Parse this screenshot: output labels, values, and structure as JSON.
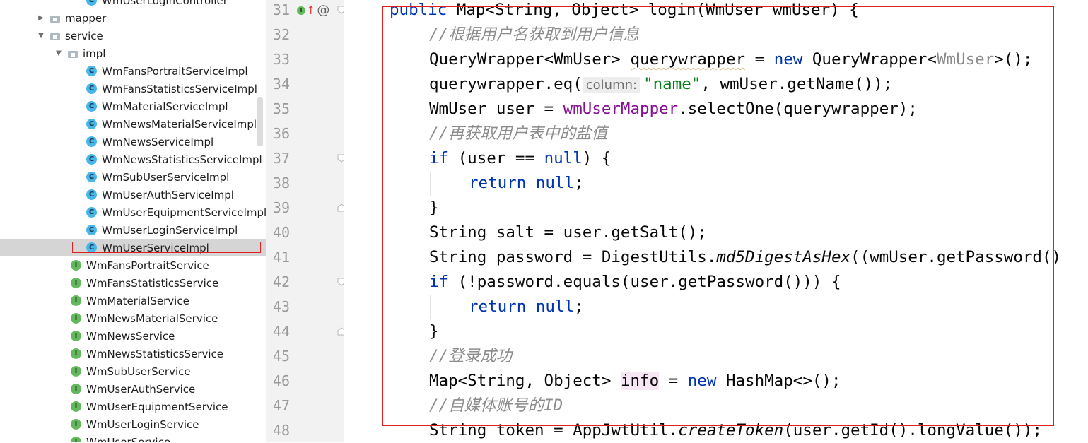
{
  "project_tree": {
    "items": [
      {
        "label": "WmUserLoginController",
        "type": "class",
        "depth": 2
      },
      {
        "label": "mapper",
        "type": "folder",
        "depth": 0,
        "expanded": false
      },
      {
        "label": "service",
        "type": "folder",
        "depth": 0,
        "expanded": true
      },
      {
        "label": "impl",
        "type": "folder",
        "depth": 1,
        "expanded": true
      },
      {
        "label": "WmFansPortraitServiceImpl",
        "type": "class",
        "depth": 2
      },
      {
        "label": "WmFansStatisticsServiceImpl",
        "type": "class",
        "depth": 2
      },
      {
        "label": "WmMaterialServiceImpl",
        "type": "class",
        "depth": 2
      },
      {
        "label": "WmNewsMaterialServiceImpl",
        "type": "class",
        "depth": 2
      },
      {
        "label": "WmNewsServiceImpl",
        "type": "class",
        "depth": 2
      },
      {
        "label": "WmNewsStatisticsServiceImpl",
        "type": "class",
        "depth": 2
      },
      {
        "label": "WmSubUserServiceImpl",
        "type": "class",
        "depth": 2
      },
      {
        "label": "WmUserAuthServiceImpl",
        "type": "class",
        "depth": 2
      },
      {
        "label": "WmUserEquipmentServiceImpl",
        "type": "class",
        "depth": 2
      },
      {
        "label": "WmUserLoginServiceImpl",
        "type": "class",
        "depth": 2
      },
      {
        "label": "WmUserServiceImpl",
        "type": "class",
        "depth": 2,
        "selected": true
      },
      {
        "label": "WmFansPortraitService",
        "type": "interface",
        "depth": 1
      },
      {
        "label": "WmFansStatisticsService",
        "type": "interface",
        "depth": 1
      },
      {
        "label": "WmMaterialService",
        "type": "interface",
        "depth": 1
      },
      {
        "label": "WmNewsMaterialService",
        "type": "interface",
        "depth": 1
      },
      {
        "label": "WmNewsService",
        "type": "interface",
        "depth": 1
      },
      {
        "label": "WmNewsStatisticsService",
        "type": "interface",
        "depth": 1
      },
      {
        "label": "WmSubUserService",
        "type": "interface",
        "depth": 1
      },
      {
        "label": "WmUserAuthService",
        "type": "interface",
        "depth": 1
      },
      {
        "label": "WmUserEquipmentService",
        "type": "interface",
        "depth": 1
      },
      {
        "label": "WmUserLoginService",
        "type": "interface",
        "depth": 1
      },
      {
        "label": "WmUserService",
        "type": "interface",
        "depth": 1
      }
    ],
    "icons": {
      "class": "C",
      "interface": "I"
    }
  },
  "gutter": {
    "line_numbers": [
      "31",
      "32",
      "33",
      "34",
      "35",
      "36",
      "37",
      "38",
      "39",
      "40",
      "41",
      "42",
      "43",
      "44",
      "45",
      "46",
      "47",
      "48"
    ],
    "impl_badge": "I",
    "override_up": "↑",
    "override_at": "@"
  },
  "colors": {
    "keyword": "#0033b3",
    "string": "#067d17",
    "field": "#871094",
    "comment": "#8c8c8c",
    "highlight_box": "#e02020",
    "selection": "#d5d5d5"
  },
  "code": {
    "lines": [
      {
        "indent": 0,
        "tokens": [
          {
            "t": "public",
            "c": "kw"
          },
          {
            "t": " Map<String, Object> login(WmUser wmUser) {"
          }
        ]
      },
      {
        "indent": 1,
        "tokens": [
          {
            "t": "//根据用户名获取到用户信息",
            "c": "cmt"
          }
        ]
      },
      {
        "indent": 1,
        "tokens": [
          {
            "t": "QueryWrapper<WmUser> "
          },
          {
            "t": "querywrapper",
            "c": "uwave"
          },
          {
            "t": " = "
          },
          {
            "t": "new",
            "c": "kw"
          },
          {
            "t": " QueryWrapper<"
          },
          {
            "t": "WmUser",
            "c": "gen"
          },
          {
            "t": ">();"
          }
        ]
      },
      {
        "indent": 1,
        "tokens": [
          {
            "t": "querywrapper.eq("
          },
          {
            "t": "column:",
            "c": "hint"
          },
          {
            "t": "\"name\"",
            "c": "str"
          },
          {
            "t": ", wmUser.getName());"
          }
        ]
      },
      {
        "indent": 1,
        "tokens": [
          {
            "t": "WmUser user = "
          },
          {
            "t": "wmUserMapper",
            "c": "field"
          },
          {
            "t": ".selectOne(querywrapper);"
          }
        ]
      },
      {
        "indent": 1,
        "tokens": [
          {
            "t": "//再获取用户表中的盐值",
            "c": "cmt"
          }
        ]
      },
      {
        "indent": 1,
        "tokens": [
          {
            "t": "if",
            "c": "kw"
          },
          {
            "t": " (user == "
          },
          {
            "t": "null",
            "c": "kw"
          },
          {
            "t": ") {"
          }
        ]
      },
      {
        "indent": 2,
        "tokens": [
          {
            "t": "return",
            "c": "kw"
          },
          {
            "t": " "
          },
          {
            "t": "null",
            "c": "kw"
          },
          {
            "t": ";"
          }
        ]
      },
      {
        "indent": 1,
        "tokens": [
          {
            "t": "}"
          }
        ]
      },
      {
        "indent": 1,
        "tokens": [
          {
            "t": "String salt = user.getSalt();"
          }
        ]
      },
      {
        "indent": 1,
        "tokens": [
          {
            "t": "String password = DigestUtils."
          },
          {
            "t": "md5DigestAsHex",
            "c": "stat"
          },
          {
            "t": "((wmUser.getPassword()"
          }
        ]
      },
      {
        "indent": 1,
        "tokens": [
          {
            "t": "if",
            "c": "kw"
          },
          {
            "t": " (!password.equals(user.getPassword())) {"
          }
        ]
      },
      {
        "indent": 2,
        "tokens": [
          {
            "t": "return",
            "c": "kw"
          },
          {
            "t": " "
          },
          {
            "t": "null",
            "c": "kw"
          },
          {
            "t": ";"
          }
        ]
      },
      {
        "indent": 1,
        "tokens": [
          {
            "t": "}"
          }
        ]
      },
      {
        "indent": 1,
        "tokens": [
          {
            "t": "//登录成功",
            "c": "cmt"
          }
        ]
      },
      {
        "indent": 1,
        "tokens": [
          {
            "t": "Map<String, Object> "
          },
          {
            "t": "info",
            "c": "hl"
          },
          {
            "t": " = "
          },
          {
            "t": "new",
            "c": "kw"
          },
          {
            "t": " HashMap<>();"
          }
        ]
      },
      {
        "indent": 1,
        "tokens": [
          {
            "t": "//自媒体账号的ID",
            "c": "cmt"
          }
        ]
      },
      {
        "indent": 1,
        "tokens": [
          {
            "t": "String token = AppJwtUtil."
          },
          {
            "t": "createToken",
            "c": "stat"
          },
          {
            "t": "(user.getId().longValue());"
          }
        ]
      }
    ]
  }
}
